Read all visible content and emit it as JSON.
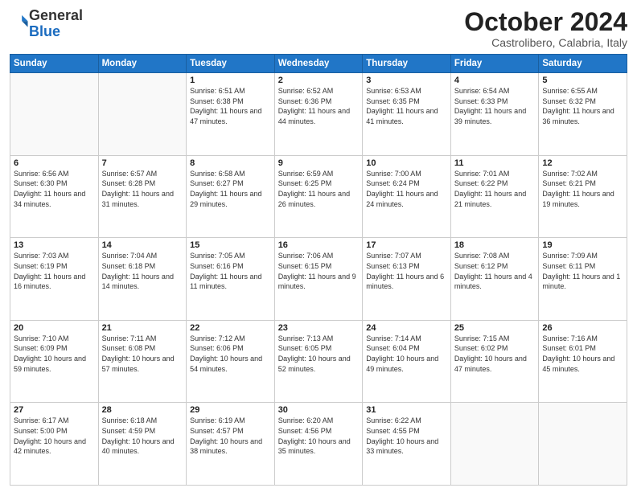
{
  "header": {
    "logo_general": "General",
    "logo_blue": "Blue",
    "month_title": "October 2024",
    "location": "Castrolibero, Calabria, Italy"
  },
  "weekdays": [
    "Sunday",
    "Monday",
    "Tuesday",
    "Wednesday",
    "Thursday",
    "Friday",
    "Saturday"
  ],
  "weeks": [
    [
      {
        "day": "",
        "sunrise": "",
        "sunset": "",
        "daylight": ""
      },
      {
        "day": "",
        "sunrise": "",
        "sunset": "",
        "daylight": ""
      },
      {
        "day": "1",
        "sunrise": "Sunrise: 6:51 AM",
        "sunset": "Sunset: 6:38 PM",
        "daylight": "Daylight: 11 hours and 47 minutes."
      },
      {
        "day": "2",
        "sunrise": "Sunrise: 6:52 AM",
        "sunset": "Sunset: 6:36 PM",
        "daylight": "Daylight: 11 hours and 44 minutes."
      },
      {
        "day": "3",
        "sunrise": "Sunrise: 6:53 AM",
        "sunset": "Sunset: 6:35 PM",
        "daylight": "Daylight: 11 hours and 41 minutes."
      },
      {
        "day": "4",
        "sunrise": "Sunrise: 6:54 AM",
        "sunset": "Sunset: 6:33 PM",
        "daylight": "Daylight: 11 hours and 39 minutes."
      },
      {
        "day": "5",
        "sunrise": "Sunrise: 6:55 AM",
        "sunset": "Sunset: 6:32 PM",
        "daylight": "Daylight: 11 hours and 36 minutes."
      }
    ],
    [
      {
        "day": "6",
        "sunrise": "Sunrise: 6:56 AM",
        "sunset": "Sunset: 6:30 PM",
        "daylight": "Daylight: 11 hours and 34 minutes."
      },
      {
        "day": "7",
        "sunrise": "Sunrise: 6:57 AM",
        "sunset": "Sunset: 6:28 PM",
        "daylight": "Daylight: 11 hours and 31 minutes."
      },
      {
        "day": "8",
        "sunrise": "Sunrise: 6:58 AM",
        "sunset": "Sunset: 6:27 PM",
        "daylight": "Daylight: 11 hours and 29 minutes."
      },
      {
        "day": "9",
        "sunrise": "Sunrise: 6:59 AM",
        "sunset": "Sunset: 6:25 PM",
        "daylight": "Daylight: 11 hours and 26 minutes."
      },
      {
        "day": "10",
        "sunrise": "Sunrise: 7:00 AM",
        "sunset": "Sunset: 6:24 PM",
        "daylight": "Daylight: 11 hours and 24 minutes."
      },
      {
        "day": "11",
        "sunrise": "Sunrise: 7:01 AM",
        "sunset": "Sunset: 6:22 PM",
        "daylight": "Daylight: 11 hours and 21 minutes."
      },
      {
        "day": "12",
        "sunrise": "Sunrise: 7:02 AM",
        "sunset": "Sunset: 6:21 PM",
        "daylight": "Daylight: 11 hours and 19 minutes."
      }
    ],
    [
      {
        "day": "13",
        "sunrise": "Sunrise: 7:03 AM",
        "sunset": "Sunset: 6:19 PM",
        "daylight": "Daylight: 11 hours and 16 minutes."
      },
      {
        "day": "14",
        "sunrise": "Sunrise: 7:04 AM",
        "sunset": "Sunset: 6:18 PM",
        "daylight": "Daylight: 11 hours and 14 minutes."
      },
      {
        "day": "15",
        "sunrise": "Sunrise: 7:05 AM",
        "sunset": "Sunset: 6:16 PM",
        "daylight": "Daylight: 11 hours and 11 minutes."
      },
      {
        "day": "16",
        "sunrise": "Sunrise: 7:06 AM",
        "sunset": "Sunset: 6:15 PM",
        "daylight": "Daylight: 11 hours and 9 minutes."
      },
      {
        "day": "17",
        "sunrise": "Sunrise: 7:07 AM",
        "sunset": "Sunset: 6:13 PM",
        "daylight": "Daylight: 11 hours and 6 minutes."
      },
      {
        "day": "18",
        "sunrise": "Sunrise: 7:08 AM",
        "sunset": "Sunset: 6:12 PM",
        "daylight": "Daylight: 11 hours and 4 minutes."
      },
      {
        "day": "19",
        "sunrise": "Sunrise: 7:09 AM",
        "sunset": "Sunset: 6:11 PM",
        "daylight": "Daylight: 11 hours and 1 minute."
      }
    ],
    [
      {
        "day": "20",
        "sunrise": "Sunrise: 7:10 AM",
        "sunset": "Sunset: 6:09 PM",
        "daylight": "Daylight: 10 hours and 59 minutes."
      },
      {
        "day": "21",
        "sunrise": "Sunrise: 7:11 AM",
        "sunset": "Sunset: 6:08 PM",
        "daylight": "Daylight: 10 hours and 57 minutes."
      },
      {
        "day": "22",
        "sunrise": "Sunrise: 7:12 AM",
        "sunset": "Sunset: 6:06 PM",
        "daylight": "Daylight: 10 hours and 54 minutes."
      },
      {
        "day": "23",
        "sunrise": "Sunrise: 7:13 AM",
        "sunset": "Sunset: 6:05 PM",
        "daylight": "Daylight: 10 hours and 52 minutes."
      },
      {
        "day": "24",
        "sunrise": "Sunrise: 7:14 AM",
        "sunset": "Sunset: 6:04 PM",
        "daylight": "Daylight: 10 hours and 49 minutes."
      },
      {
        "day": "25",
        "sunrise": "Sunrise: 7:15 AM",
        "sunset": "Sunset: 6:02 PM",
        "daylight": "Daylight: 10 hours and 47 minutes."
      },
      {
        "day": "26",
        "sunrise": "Sunrise: 7:16 AM",
        "sunset": "Sunset: 6:01 PM",
        "daylight": "Daylight: 10 hours and 45 minutes."
      }
    ],
    [
      {
        "day": "27",
        "sunrise": "Sunrise: 6:17 AM",
        "sunset": "Sunset: 5:00 PM",
        "daylight": "Daylight: 10 hours and 42 minutes."
      },
      {
        "day": "28",
        "sunrise": "Sunrise: 6:18 AM",
        "sunset": "Sunset: 4:59 PM",
        "daylight": "Daylight: 10 hours and 40 minutes."
      },
      {
        "day": "29",
        "sunrise": "Sunrise: 6:19 AM",
        "sunset": "Sunset: 4:57 PM",
        "daylight": "Daylight: 10 hours and 38 minutes."
      },
      {
        "day": "30",
        "sunrise": "Sunrise: 6:20 AM",
        "sunset": "Sunset: 4:56 PM",
        "daylight": "Daylight: 10 hours and 35 minutes."
      },
      {
        "day": "31",
        "sunrise": "Sunrise: 6:22 AM",
        "sunset": "Sunset: 4:55 PM",
        "daylight": "Daylight: 10 hours and 33 minutes."
      },
      {
        "day": "",
        "sunrise": "",
        "sunset": "",
        "daylight": ""
      },
      {
        "day": "",
        "sunrise": "",
        "sunset": "",
        "daylight": ""
      }
    ]
  ]
}
